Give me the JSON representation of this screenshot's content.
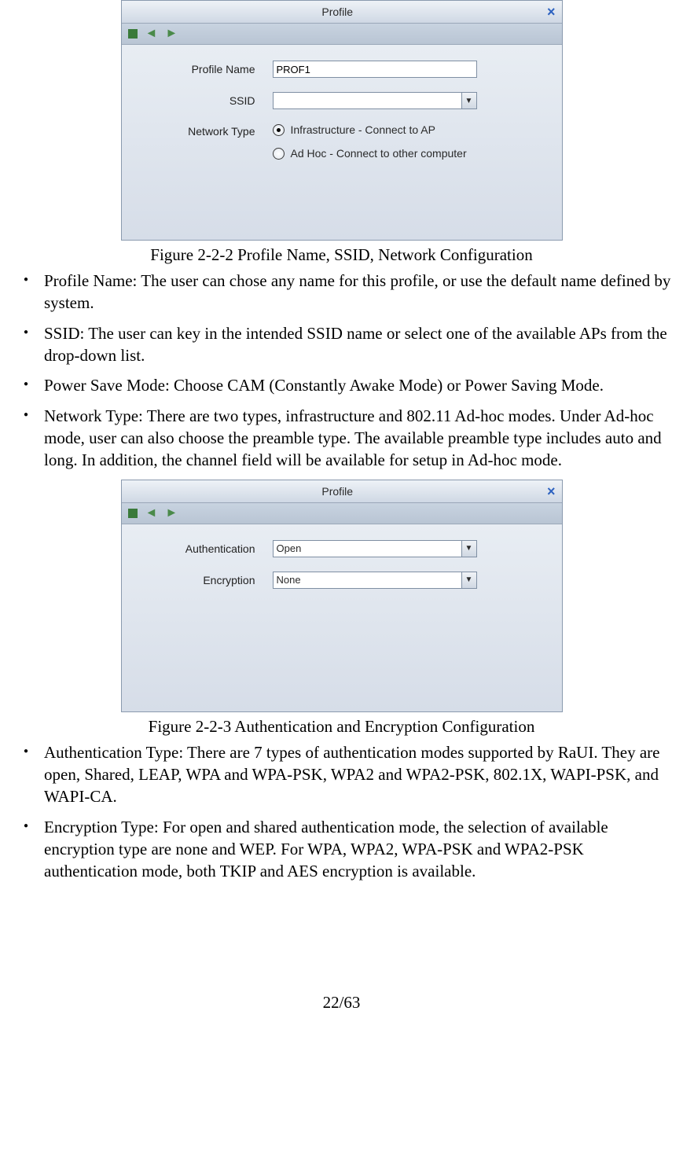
{
  "dialog1": {
    "title": "Profile",
    "toolbar": {
      "back": "←",
      "fwd": "→"
    },
    "profile_name_label": "Profile Name",
    "profile_name_value": "PROF1",
    "ssid_label": "SSID",
    "ssid_value": "",
    "network_type_label": "Network Type",
    "radio_infra": "Infrastructure - Connect to AP",
    "radio_adhoc": "Ad Hoc - Connect to other computer"
  },
  "caption1": "Figure 2-2-2 Profile Name, SSID, Network Configuration",
  "bullets1": [
    "Profile Name: The user can chose any name for this profile, or use the default name defined by system.",
    "SSID: The user can key in the intended SSID name or select one of the available APs from the drop-down list.",
    "Power Save Mode: Choose CAM (Constantly Awake Mode) or Power Saving Mode.",
    "Network Type: There are two types, infrastructure and 802.11 Ad-hoc modes. Under Ad-hoc mode, user can also choose the preamble type. The available preamble type includes auto and long. In addition, the channel field will be available for setup in Ad-hoc mode."
  ],
  "dialog2": {
    "title": "Profile",
    "auth_label": "Authentication",
    "auth_value": "Open",
    "enc_label": "Encryption",
    "enc_value": "None"
  },
  "caption2": "Figure 2-2-3 Authentication and Encryption Configuration",
  "bullets2": [
    "Authentication Type: There are 7 types of authentication modes supported by RaUI. They are open, Shared, LEAP, WPA and WPA-PSK, WPA2 and WPA2-PSK, 802.1X, WAPI-PSK, and WAPI-CA.",
    "Encryption Type: For open and shared authentication mode, the selection of available encryption type are none and WEP. For WPA, WPA2, WPA-PSK and WPA2-PSK authentication mode, both TKIP and AES encryption is available."
  ],
  "pagenum": "22/63"
}
